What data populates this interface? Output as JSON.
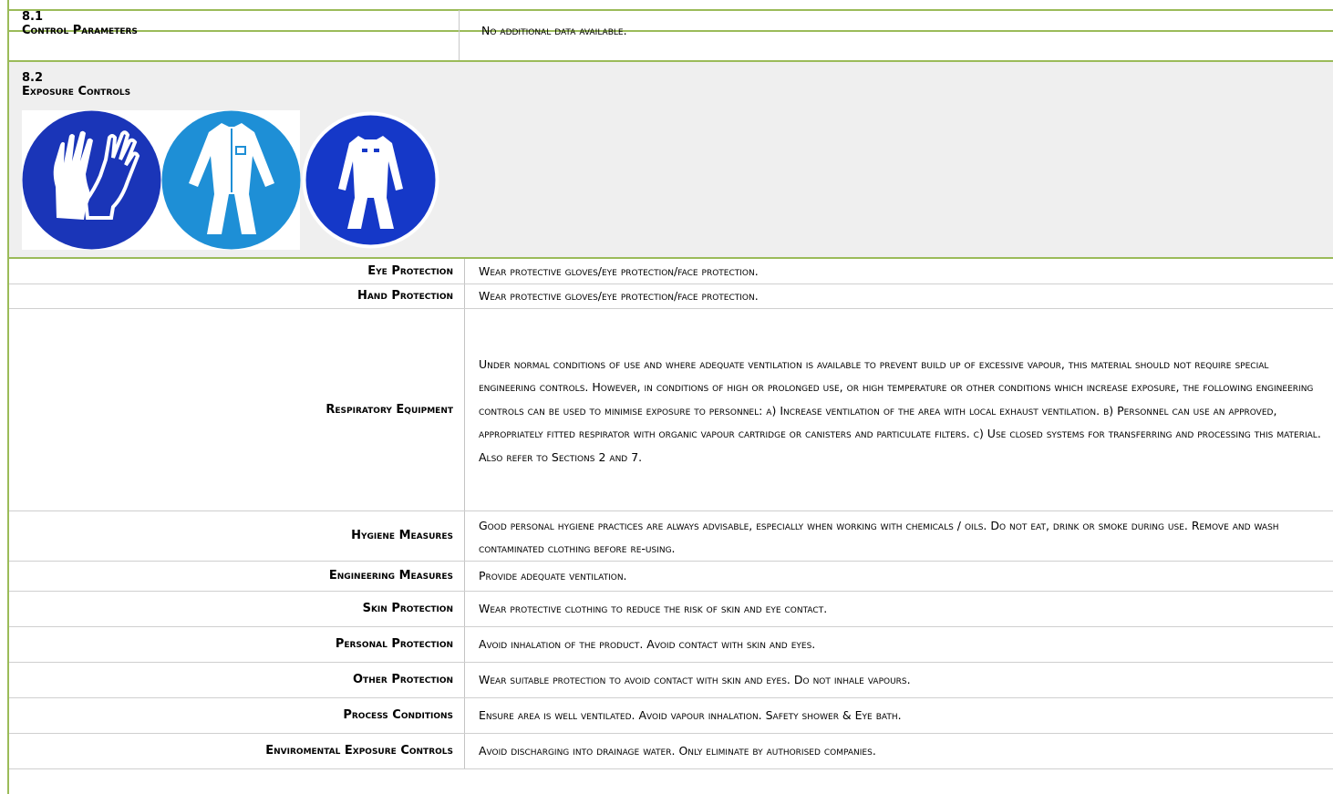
{
  "section_81": {
    "number": "8.1",
    "title": "Control Parameters",
    "value": "No additional data available."
  },
  "section_82": {
    "number": "8.2",
    "title": "Exposure Controls",
    "icons": [
      "gloves-icon",
      "coverall-icon",
      "protective-suit-icon"
    ]
  },
  "colors": {
    "border_green": "#9bbb59",
    "panel_gray": "#efefef",
    "glove_blue": "#1a35b8",
    "coverall_blue": "#1e8fd6",
    "suit_blue": "#1538c8"
  },
  "rows": [
    {
      "label": "Eye Protection",
      "value": "Wear protective gloves/eye protection/face protection."
    },
    {
      "label": "Hand Protection",
      "value": "Wear protective gloves/eye protection/face protection."
    },
    {
      "label": "Respiratory Equipment",
      "value": "Under normal conditions of use and where adequate ventilation is available to prevent build up of excessive vapour, this material should not require special engineering controls. However, in conditions of high or prolonged use, or high temperature or other conditions which increase exposure, the following engineering controls can be used to minimise exposure to personnel: a) Increase ventilation of the area with local exhaust ventilation. b) Personnel can use an approved, appropriately fitted respirator with organic vapour cartridge or canisters and particulate filters. c) Use closed systems for transferring and processing this material. Also refer to Sections 2 and 7."
    },
    {
      "label": "Hygiene Measures",
      "value": "Good personal hygiene practices are always advisable, especially when working with chemicals / oils. Do not eat, drink or smoke during use. Remove and wash contaminated clothing before re-using."
    },
    {
      "label": "Engineering Measures",
      "value": "Provide adequate ventilation."
    },
    {
      "label": "Skin Protection",
      "value": "Wear protective clothing to reduce the risk of skin and eye contact."
    },
    {
      "label": "Personal Protection",
      "value": "Avoid inhalation of the product. Avoid contact with skin and eyes."
    },
    {
      "label": "Other Protection",
      "value": "Wear suitable protection to avoid contact with skin and eyes. Do not inhale vapours."
    },
    {
      "label": "Process Conditions",
      "value": "Ensure area is well ventilated. Avoid vapour inhalation. Safety shower & Eye bath."
    },
    {
      "label": "Enviromental Exposure Controls",
      "value": "Avoid discharging into drainage water. Only eliminate by authorised companies."
    }
  ]
}
